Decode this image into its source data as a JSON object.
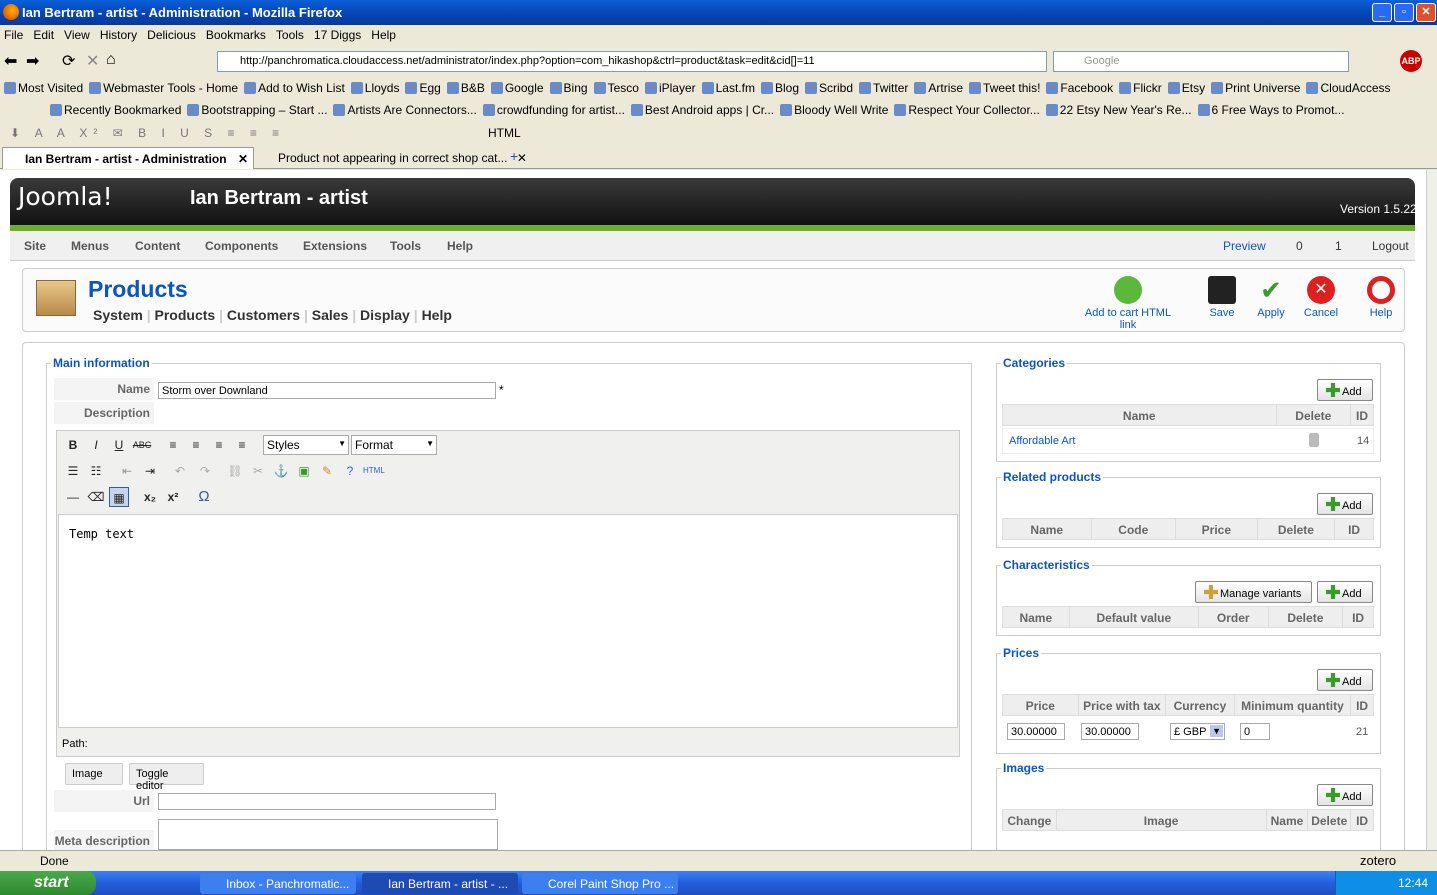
{
  "window": {
    "title": "Ian Bertram - artist - Administration - Mozilla Firefox"
  },
  "menu": [
    "File",
    "Edit",
    "View",
    "History",
    "Delicious",
    "Bookmarks",
    "Tools",
    "17 Diggs",
    "Help"
  ],
  "url": "http://panchromatica.cloudaccess.net/administrator/index.php?option=com_hikashop&ctrl=product&task=edit&cid[]=11",
  "search_placeholder": "Google",
  "bookmarks1": [
    "Most Visited",
    "Webmaster Tools - Home",
    "Add to Wish List",
    "Lloyds",
    "Egg",
    "B&B",
    "Google",
    "Bing",
    "Tesco",
    "iPlayer",
    "Last.fm",
    "Blog",
    "Scribd",
    "Twitter",
    "Artrise",
    "Tweet this!",
    "Facebook",
    "Flickr",
    "Etsy",
    "Print Universe",
    "CloudAccess"
  ],
  "bookmarks2": [
    "Recently Bookmarked",
    "Bootstrapping – Start ...",
    "Artists Are Connectors...",
    "crowdfunding for artist...",
    "Best Android apps | Cr...",
    "Bloody Well Write",
    "Respect Your Collector...",
    "22 Etsy New Year's Re...",
    "6 Free Ways to Promot..."
  ],
  "editorbar_html": "HTML",
  "tabs": [
    "Ian Bertram - artist - Administration",
    "Product not appearing in correct shop cat..."
  ],
  "joomla": {
    "logo": "Joomla!",
    "site": "Ian Bertram - artist",
    "version": "Version 1.5.22"
  },
  "admin_menu": [
    "Site",
    "Menus",
    "Content",
    "Components",
    "Extensions",
    "Tools",
    "Help"
  ],
  "admin_right": {
    "preview": "Preview",
    "msgs": "0",
    "users": "1",
    "logout": "Logout"
  },
  "page_title": "Products",
  "submenu": [
    "System",
    "Products",
    "Customers",
    "Sales",
    "Display",
    "Help"
  ],
  "toolbar": {
    "addcart": "Add to cart HTML link",
    "save": "Save",
    "apply": "Apply",
    "cancel": "Cancel",
    "help": "Help"
  },
  "main": {
    "legend": "Main information",
    "name_label": "Name",
    "name_value": "Storm over Downland",
    "required": "*",
    "desc_label": "Description",
    "styles": "Styles",
    "format": "Format",
    "content": "Temp text",
    "path": "Path:",
    "image_btn": "Image",
    "toggle_btn": "Toggle editor",
    "url_label": "Url",
    "meta_label": "Meta description"
  },
  "categories": {
    "legend": "Categories",
    "add": "Add",
    "cols": [
      "Name",
      "Delete",
      "ID"
    ],
    "row": {
      "name": "Affordable Art",
      "id": "14"
    }
  },
  "related": {
    "legend": "Related products",
    "add": "Add",
    "cols": [
      "Name",
      "Code",
      "Price",
      "Delete",
      "ID"
    ]
  },
  "characteristics": {
    "legend": "Characteristics",
    "manage": "Manage variants",
    "add": "Add",
    "cols": [
      "Name",
      "Default value",
      "Order",
      "Delete",
      "ID"
    ]
  },
  "prices": {
    "legend": "Prices",
    "add": "Add",
    "cols": [
      "Price",
      "Price with tax",
      "Currency",
      "Minimum quantity",
      "ID"
    ],
    "row": {
      "price": "30.00000",
      "price_tax": "30.00000",
      "currency": "£ GBP",
      "min_qty": "0",
      "id": "21"
    }
  },
  "images": {
    "legend": "Images",
    "add": "Add",
    "cols": [
      "Change",
      "Image",
      "Name",
      "Delete",
      "ID"
    ]
  },
  "status": {
    "text": "Done",
    "zotero": "zotero"
  },
  "taskbar": {
    "start": "start",
    "tasks": [
      "Inbox - Panchromatic...",
      "Ian Bertram - artist - ...",
      "Corel Paint Shop Pro ..."
    ],
    "time": "12:44"
  }
}
